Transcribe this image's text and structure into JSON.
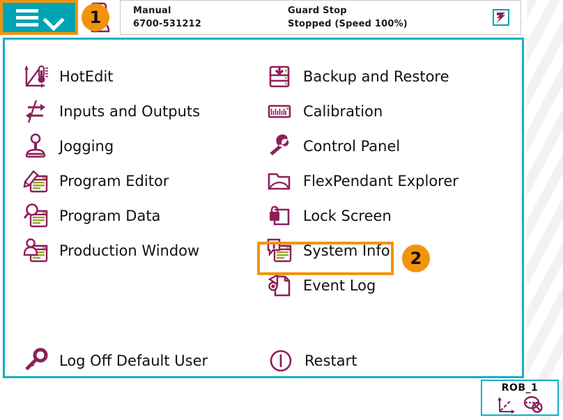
{
  "colors": {
    "teal": "#00a3b4",
    "panel_border": "#12b0c6",
    "accent_orange": "#f2930d",
    "icon_purple": "#8e1f5a",
    "text": "#111111"
  },
  "header": {
    "menu_button": {
      "name": "main-menu-button",
      "hamburger_icon": "hamburger-icon",
      "chevron_icon": "chevron-down-icon"
    },
    "operator_icon": "operator-user-icon",
    "badge_1": "1",
    "mode": {
      "line1": "Manual",
      "line2": "6700-531212"
    },
    "guard": {
      "line1": "Guard Stop",
      "line2": "Stopped (Speed 100%)"
    },
    "stop_indicator_icon": "motors-off-icon"
  },
  "menu": {
    "left_column": [
      {
        "label": "HotEdit",
        "icon": "hotedit-icon"
      },
      {
        "label": "Inputs and Outputs",
        "icon": "inputs-outputs-icon"
      },
      {
        "label": "Jogging",
        "icon": "jogging-joystick-icon"
      },
      {
        "label": "Program Editor",
        "icon": "program-editor-icon"
      },
      {
        "label": "Program Data",
        "icon": "program-data-icon"
      },
      {
        "label": "Production Window",
        "icon": "production-window-icon"
      }
    ],
    "right_column": [
      {
        "label": "Backup and Restore",
        "icon": "backup-restore-icon"
      },
      {
        "label": "Calibration",
        "icon": "calibration-icon"
      },
      {
        "label": "Control Panel",
        "icon": "wrench-icon"
      },
      {
        "label": "FlexPendant Explorer",
        "icon": "folder-icon"
      },
      {
        "label": "Lock Screen",
        "icon": "lock-screen-icon"
      },
      {
        "label": "System Info",
        "icon": "system-info-icon",
        "highlighted": true
      },
      {
        "label": "Event Log",
        "icon": "event-log-icon"
      }
    ],
    "bottom_row": [
      {
        "label": "Log Off Default User",
        "icon": "key-icon"
      },
      {
        "label": "Restart",
        "icon": "restart-power-icon"
      }
    ],
    "badge_2": "2"
  },
  "taskbar": {
    "robot_tab": {
      "label": "ROB_1",
      "coord_icon": "coordinate-axes-icon",
      "status_icon": "robot-status-icon"
    }
  }
}
